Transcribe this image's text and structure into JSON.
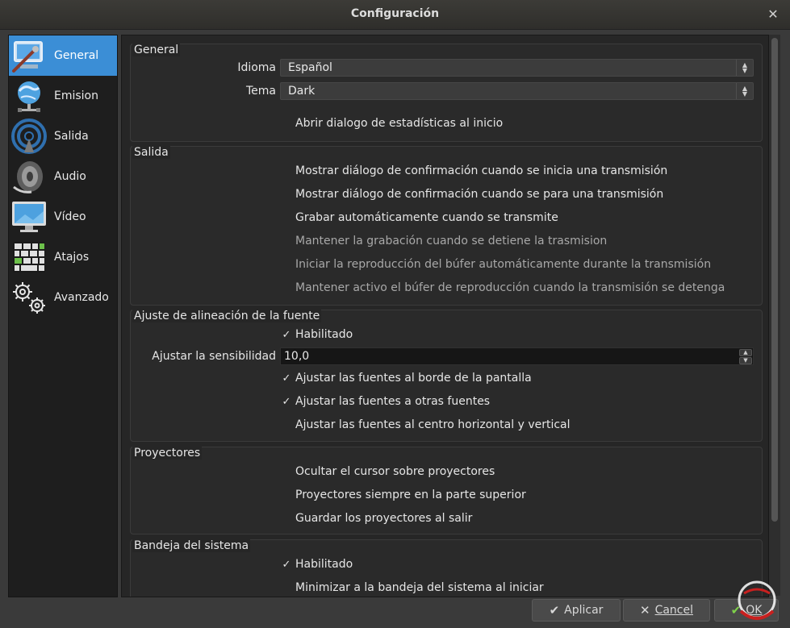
{
  "window": {
    "title": "Configuración"
  },
  "sidebar": {
    "items": [
      {
        "label": "General",
        "icon": "general-icon",
        "selected": true
      },
      {
        "label": "Emision",
        "icon": "globe-icon"
      },
      {
        "label": "Salida",
        "icon": "antenna-icon"
      },
      {
        "label": "Audio",
        "icon": "speaker-icon"
      },
      {
        "label": "Vídeo",
        "icon": "monitor-icon"
      },
      {
        "label": "Atajos",
        "icon": "keyboard-icon"
      },
      {
        "label": "Avanzado",
        "icon": "gears-icon"
      }
    ]
  },
  "general": {
    "title": "General",
    "language_label": "Idioma",
    "language_value": "Español",
    "theme_label": "Tema",
    "theme_value": "Dark",
    "stats_dialog": "Abrir dialogo de estadísticas al inicio"
  },
  "output": {
    "title": "Salida",
    "options": [
      "Mostrar diálogo de confirmación cuando se inicia una transmisión",
      "Mostrar diálogo de confirmación cuando se para una transmisión",
      "Grabar automáticamente cuando se transmite",
      "Mantener la grabación cuando se detiene la trasmision",
      "Iniciar la reproducción del búfer automáticamente durante la transmisión",
      "Mantener activo el búfer de reproducción cuando la transmisión se detenga"
    ]
  },
  "snapping": {
    "title": "Ajuste de alineación de la fuente",
    "enabled": "Habilitado",
    "sensitivity_label": "Ajustar la sensibilidad",
    "sensitivity_value": "10,0",
    "screen_edge": "Ajustar las fuentes al borde de la pantalla",
    "other_sources": "Ajustar las fuentes a otras fuentes",
    "center": "Ajustar las fuentes al centro horizontal y vertical"
  },
  "projectors": {
    "title": "Proyectores",
    "hide_cursor": "Ocultar el cursor sobre proyectores",
    "always_on_top": "Proyectores siempre en la parte superior",
    "save_on_exit": "Guardar los proyectores al salir"
  },
  "tray": {
    "title": "Bandeja del sistema",
    "enabled": "Habilitado",
    "minimize_on_start": "Minimizar a la bandeja del sistema al iniciar"
  },
  "checkmark": "✓",
  "footer": {
    "apply": "Aplicar",
    "cancel": "Cancel",
    "ok": "OK"
  },
  "colors": {
    "selection": "#3b8ed6",
    "background": "#262626"
  }
}
